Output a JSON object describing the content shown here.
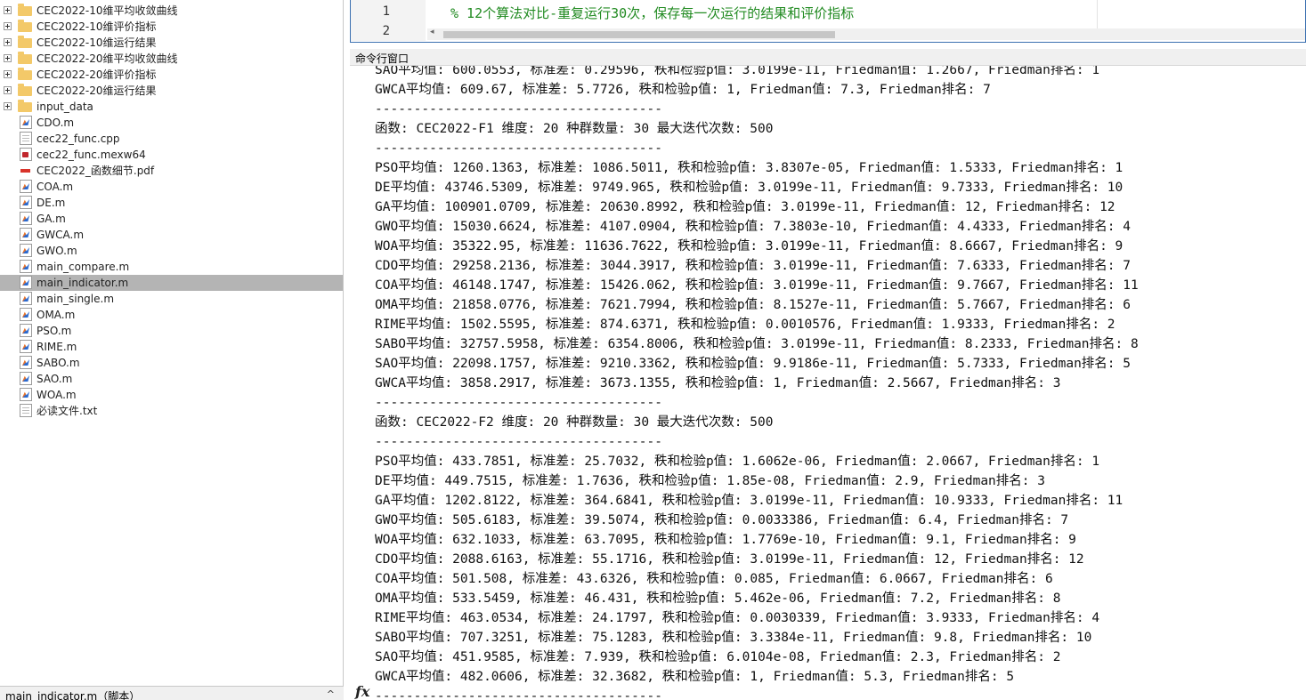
{
  "file_browser": {
    "items": [
      {
        "name": "CEC2022-10维平均收敛曲线",
        "kind": "folder",
        "expandable": true
      },
      {
        "name": "CEC2022-10维评价指标",
        "kind": "folder",
        "expandable": true
      },
      {
        "name": "CEC2022-10维运行结果",
        "kind": "folder",
        "expandable": true
      },
      {
        "name": "CEC2022-20维平均收敛曲线",
        "kind": "folder",
        "expandable": true
      },
      {
        "name": "CEC2022-20维评价指标",
        "kind": "folder",
        "expandable": true
      },
      {
        "name": "CEC2022-20维运行结果",
        "kind": "folder",
        "expandable": true
      },
      {
        "name": "input_data",
        "kind": "folder",
        "expandable": true
      },
      {
        "name": "CDO.m",
        "kind": "m"
      },
      {
        "name": "cec22_func.cpp",
        "kind": "doc"
      },
      {
        "name": "cec22_func.mexw64",
        "kind": "mex"
      },
      {
        "name": "CEC2022_函数细节.pdf",
        "kind": "pdf"
      },
      {
        "name": "COA.m",
        "kind": "m"
      },
      {
        "name": "DE.m",
        "kind": "m"
      },
      {
        "name": "GA.m",
        "kind": "m"
      },
      {
        "name": "GWCA.m",
        "kind": "m"
      },
      {
        "name": "GWO.m",
        "kind": "m"
      },
      {
        "name": "main_compare.m",
        "kind": "m"
      },
      {
        "name": "main_indicator.m",
        "kind": "m",
        "selected": true
      },
      {
        "name": "main_single.m",
        "kind": "m"
      },
      {
        "name": "OMA.m",
        "kind": "m"
      },
      {
        "name": "PSO.m",
        "kind": "m"
      },
      {
        "name": "RIME.m",
        "kind": "m"
      },
      {
        "name": "SABO.m",
        "kind": "m"
      },
      {
        "name": "SAO.m",
        "kind": "m"
      },
      {
        "name": "WOA.m",
        "kind": "m"
      },
      {
        "name": "必读文件.txt",
        "kind": "doc"
      }
    ],
    "detail_label": "main_indicator.m（脚本）",
    "detail_chevron": "^",
    "selected_color": "#b4b4b4"
  },
  "editor": {
    "line_numbers": [
      "1",
      "2"
    ],
    "line1_code": "% 12个算法对比-重复运行30次，保存每一次运行的结果和评价指标",
    "scroll_left_arrow": "◂"
  },
  "command_window": {
    "title": "命令行窗口",
    "prompt_icon": "fx",
    "lines": [
      "SAO平均值: 600.0553, 标准差: 0.29596, 秩和检验p值: 3.0199e-11, Friedman值: 1.2667, Friedman排名: 1",
      "GWCA平均值: 609.67, 标准差: 5.7726, 秩和检验p值: 1, Friedman值: 7.3, Friedman排名: 7",
      "-------------------------------------",
      "函数: CEC2022-F1 维度: 20 种群数量: 30 最大迭代次数: 500",
      "-------------------------------------",
      "PSO平均值: 1260.1363, 标准差: 1086.5011, 秩和检验p值: 3.8307e-05, Friedman值: 1.5333, Friedman排名: 1",
      "DE平均值: 43746.5309, 标准差: 9749.965, 秩和检验p值: 3.0199e-11, Friedman值: 9.7333, Friedman排名: 10",
      "GA平均值: 100901.0709, 标准差: 20630.8992, 秩和检验p值: 3.0199e-11, Friedman值: 12, Friedman排名: 12",
      "GWO平均值: 15030.6624, 标准差: 4107.0904, 秩和检验p值: 7.3803e-10, Friedman值: 4.4333, Friedman排名: 4",
      "WOA平均值: 35322.95, 标准差: 11636.7622, 秩和检验p值: 3.0199e-11, Friedman值: 8.6667, Friedman排名: 9",
      "CDO平均值: 29258.2136, 标准差: 3044.3917, 秩和检验p值: 3.0199e-11, Friedman值: 7.6333, Friedman排名: 7",
      "COA平均值: 46148.1747, 标准差: 15426.062, 秩和检验p值: 3.0199e-11, Friedman值: 9.7667, Friedman排名: 11",
      "OMA平均值: 21858.0776, 标准差: 7621.7994, 秩和检验p值: 8.1527e-11, Friedman值: 5.7667, Friedman排名: 6",
      "RIME平均值: 1502.5595, 标准差: 874.6371, 秩和检验p值: 0.0010576, Friedman值: 1.9333, Friedman排名: 2",
      "SABO平均值: 32757.5958, 标准差: 6354.8006, 秩和检验p值: 3.0199e-11, Friedman值: 8.2333, Friedman排名: 8",
      "SAO平均值: 22098.1757, 标准差: 9210.3362, 秩和检验p值: 9.9186e-11, Friedman值: 5.7333, Friedman排名: 5",
      "GWCA平均值: 3858.2917, 标准差: 3673.1355, 秩和检验p值: 1, Friedman值: 2.5667, Friedman排名: 3",
      "-------------------------------------",
      "函数: CEC2022-F2 维度: 20 种群数量: 30 最大迭代次数: 500",
      "-------------------------------------",
      "PSO平均值: 433.7851, 标准差: 25.7032, 秩和检验p值: 1.6062e-06, Friedman值: 2.0667, Friedman排名: 1",
      "DE平均值: 449.7515, 标准差: 1.7636, 秩和检验p值: 1.85e-08, Friedman值: 2.9, Friedman排名: 3",
      "GA平均值: 1202.8122, 标准差: 364.6841, 秩和检验p值: 3.0199e-11, Friedman值: 10.9333, Friedman排名: 11",
      "GWO平均值: 505.6183, 标准差: 39.5074, 秩和检验p值: 0.0033386, Friedman值: 6.4, Friedman排名: 7",
      "WOA平均值: 632.1033, 标准差: 63.7095, 秩和检验p值: 1.7769e-10, Friedman值: 9.1, Friedman排名: 9",
      "CDO平均值: 2088.6163, 标准差: 55.1716, 秩和检验p值: 3.0199e-11, Friedman值: 12, Friedman排名: 12",
      "COA平均值: 501.508, 标准差: 43.6326, 秩和检验p值: 0.085, Friedman值: 6.0667, Friedman排名: 6",
      "OMA平均值: 533.5459, 标准差: 46.431, 秩和检验p值: 5.462e-06, Friedman值: 7.2, Friedman排名: 8",
      "RIME平均值: 463.0534, 标准差: 24.1797, 秩和检验p值: 0.0030339, Friedman值: 3.9333, Friedman排名: 4",
      "SABO平均值: 707.3251, 标准差: 75.1283, 秩和检验p值: 3.3384e-11, Friedman值: 9.8, Friedman排名: 10",
      "SAO平均值: 451.9585, 标准差: 7.939, 秩和检验p值: 6.0104e-08, Friedman值: 2.3, Friedman排名: 2",
      "GWCA平均值: 482.0606, 标准差: 32.3682, 秩和检验p值: 1, Friedman值: 5.3, Friedman排名: 5",
      "-------------------------------------"
    ]
  },
  "colors": {
    "comment_green": "#228b22",
    "editor_border_blue": "#3a6fb0"
  }
}
